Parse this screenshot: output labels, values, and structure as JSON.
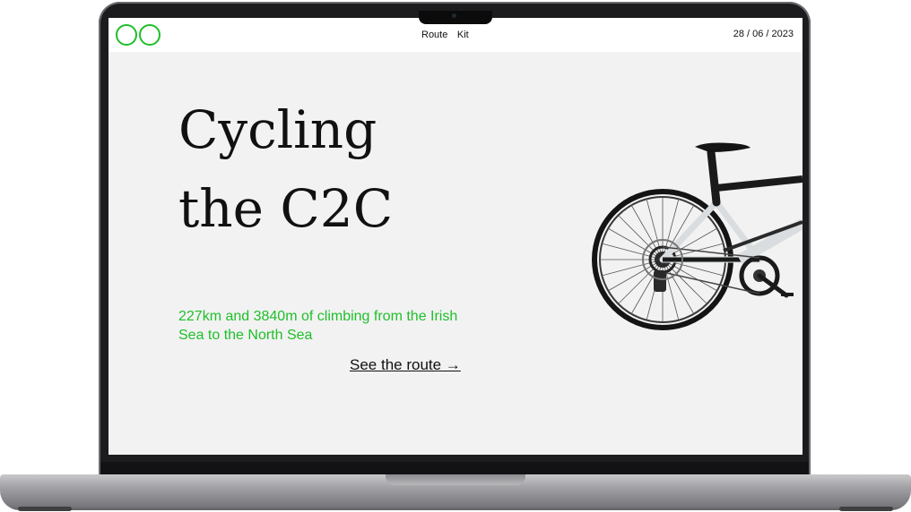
{
  "site": {
    "nav": [
      "Route",
      "Kit"
    ],
    "date": "28 / 06 / 2023"
  },
  "hero": {
    "title_line1": "Cycling",
    "title_line2": "the C2C",
    "subtitle": "227km and 3840m of climbing from the Irish Sea to the North Sea",
    "cta_label": "See the route →"
  },
  "colors": {
    "accent": "#1fbf2a",
    "background": "#f2f2f2",
    "text": "#111111"
  }
}
